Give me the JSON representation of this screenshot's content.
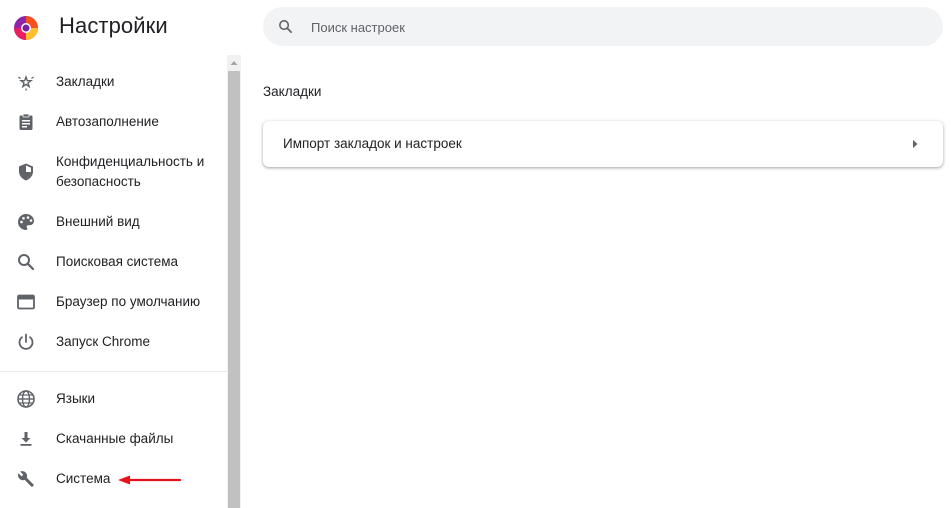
{
  "header": {
    "title": "Настройки",
    "search": {
      "placeholder": "Поиск настроек",
      "value": ""
    }
  },
  "sidebar": {
    "items": [
      {
        "label": "Закладки",
        "icon": "bookmark-star-icon"
      },
      {
        "label": "Автозаполнение",
        "icon": "clipboard-icon"
      },
      {
        "label": "Конфиденциальность и",
        "label2": "безопасность",
        "icon": "shield-icon"
      },
      {
        "label": "Внешний вид",
        "icon": "palette-icon"
      },
      {
        "label": "Поисковая система",
        "icon": "search-icon"
      },
      {
        "label": "Браузер по умолчанию",
        "icon": "browser-window-icon"
      },
      {
        "label": "Запуск Chrome",
        "icon": "power-icon"
      },
      {
        "label": "Языки",
        "icon": "globe-icon"
      },
      {
        "label": "Скачанные файлы",
        "icon": "download-icon"
      },
      {
        "label": "Система",
        "icon": "wrench-icon"
      }
    ]
  },
  "main": {
    "section_title": "Закладки",
    "card": {
      "label": "Импорт закладок и настроек"
    }
  },
  "colors": {
    "icon": "#5f6368",
    "text": "#202124",
    "search_bg": "#f1f3f4",
    "annotation": "#e8101a"
  }
}
